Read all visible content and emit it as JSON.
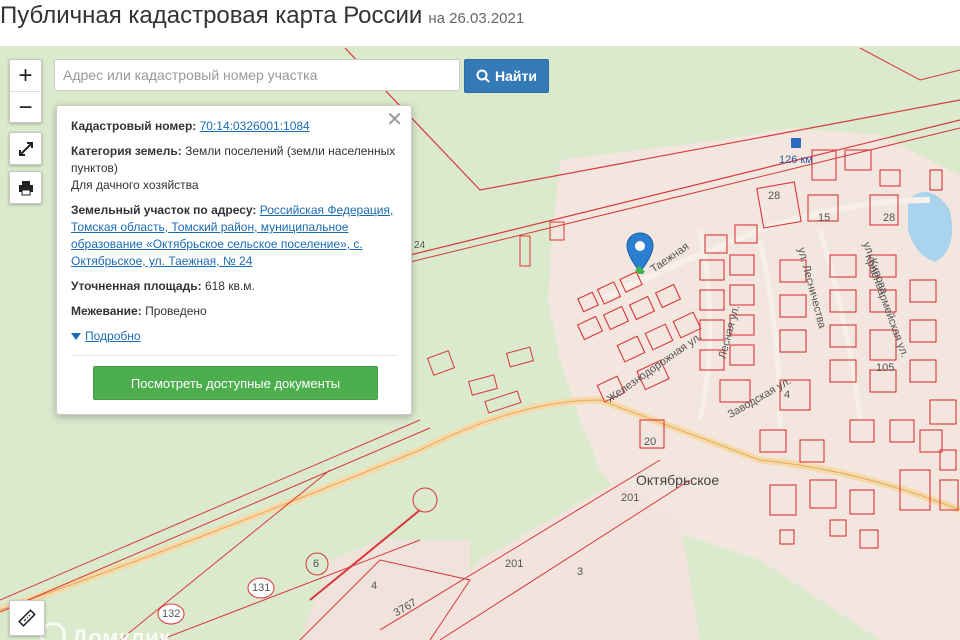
{
  "header": {
    "title": "Публичная кадастровая карта России",
    "date": "на 26.03.2021"
  },
  "controls": {
    "zoom_in": "+",
    "zoom_out": "−"
  },
  "search": {
    "placeholder": "Адрес или кадастровый номер участка",
    "button_label": "Найти"
  },
  "popup": {
    "cadastral_number_label": "Кадастровый номер:",
    "cadastral_number": "70:14:0326001:1084",
    "land_category_label": "Категория земель:",
    "land_category": "Земли поселений (земли населенных пунктов)",
    "permitted_use": "Для дачного хозяйства",
    "address_label": "Земельный участок по адресу:",
    "address": "Российская Федерация, Томская область, Томский район, муниципальное образование «Октябрьское сельское поселение», с. Октябрьское, ул. Таежная, № 24",
    "area_label": "Уточненная площадь:",
    "area": "618 кв.м.",
    "survey_label": "Межевание:",
    "survey": "Проведено",
    "more_link": "Подробно",
    "docs_button": "Посмотреть доступные документы"
  },
  "map_labels": {
    "km": "126 км",
    "settlement": "Октябрьское",
    "road_24": "24",
    "n_28a": "28",
    "n_28b": "28",
    "n_15": "15",
    "n_20": "20",
    "n_201a": "201",
    "n_201b": "201",
    "n_3": "3",
    "n_4a": "4",
    "n_4b": "4",
    "n_105": "105",
    "n_131": "131",
    "n_132": "132",
    "n_6": "6",
    "n_3767": "3767",
    "street_taezhnaya": "Таежная",
    "street_zheleznodorozhnaya": "Железнодорожная ул.",
    "street_lesnaya": "Лесная ул.",
    "street_zavodskaya": "Заводская ул.",
    "street_lesnichestvo": "ул. Лесничества",
    "street_kirova": "ул. Кирова",
    "street_krasnoarmeyskaya": "Красноармейская ул."
  },
  "watermark": "Домклик",
  "colors": {
    "forest": "#dbe9cc",
    "settlement": "#f3e6df",
    "parcel_border": "#d9383a",
    "road": "#f6d9a8",
    "water": "#aad3ee",
    "button_blue": "#337ab7",
    "button_green": "#4cae4c",
    "link": "#1a6bb5",
    "marker": "#2a7fd0"
  },
  "icons": {
    "search_button": "search-icon",
    "fullscreen": "expand-icon",
    "print": "printer-icon",
    "close": "close-icon",
    "marker": "map-pin-icon",
    "more": "triangle-down-icon",
    "ruler": "ruler-icon",
    "bus_stop": "bus-stop-icon"
  }
}
